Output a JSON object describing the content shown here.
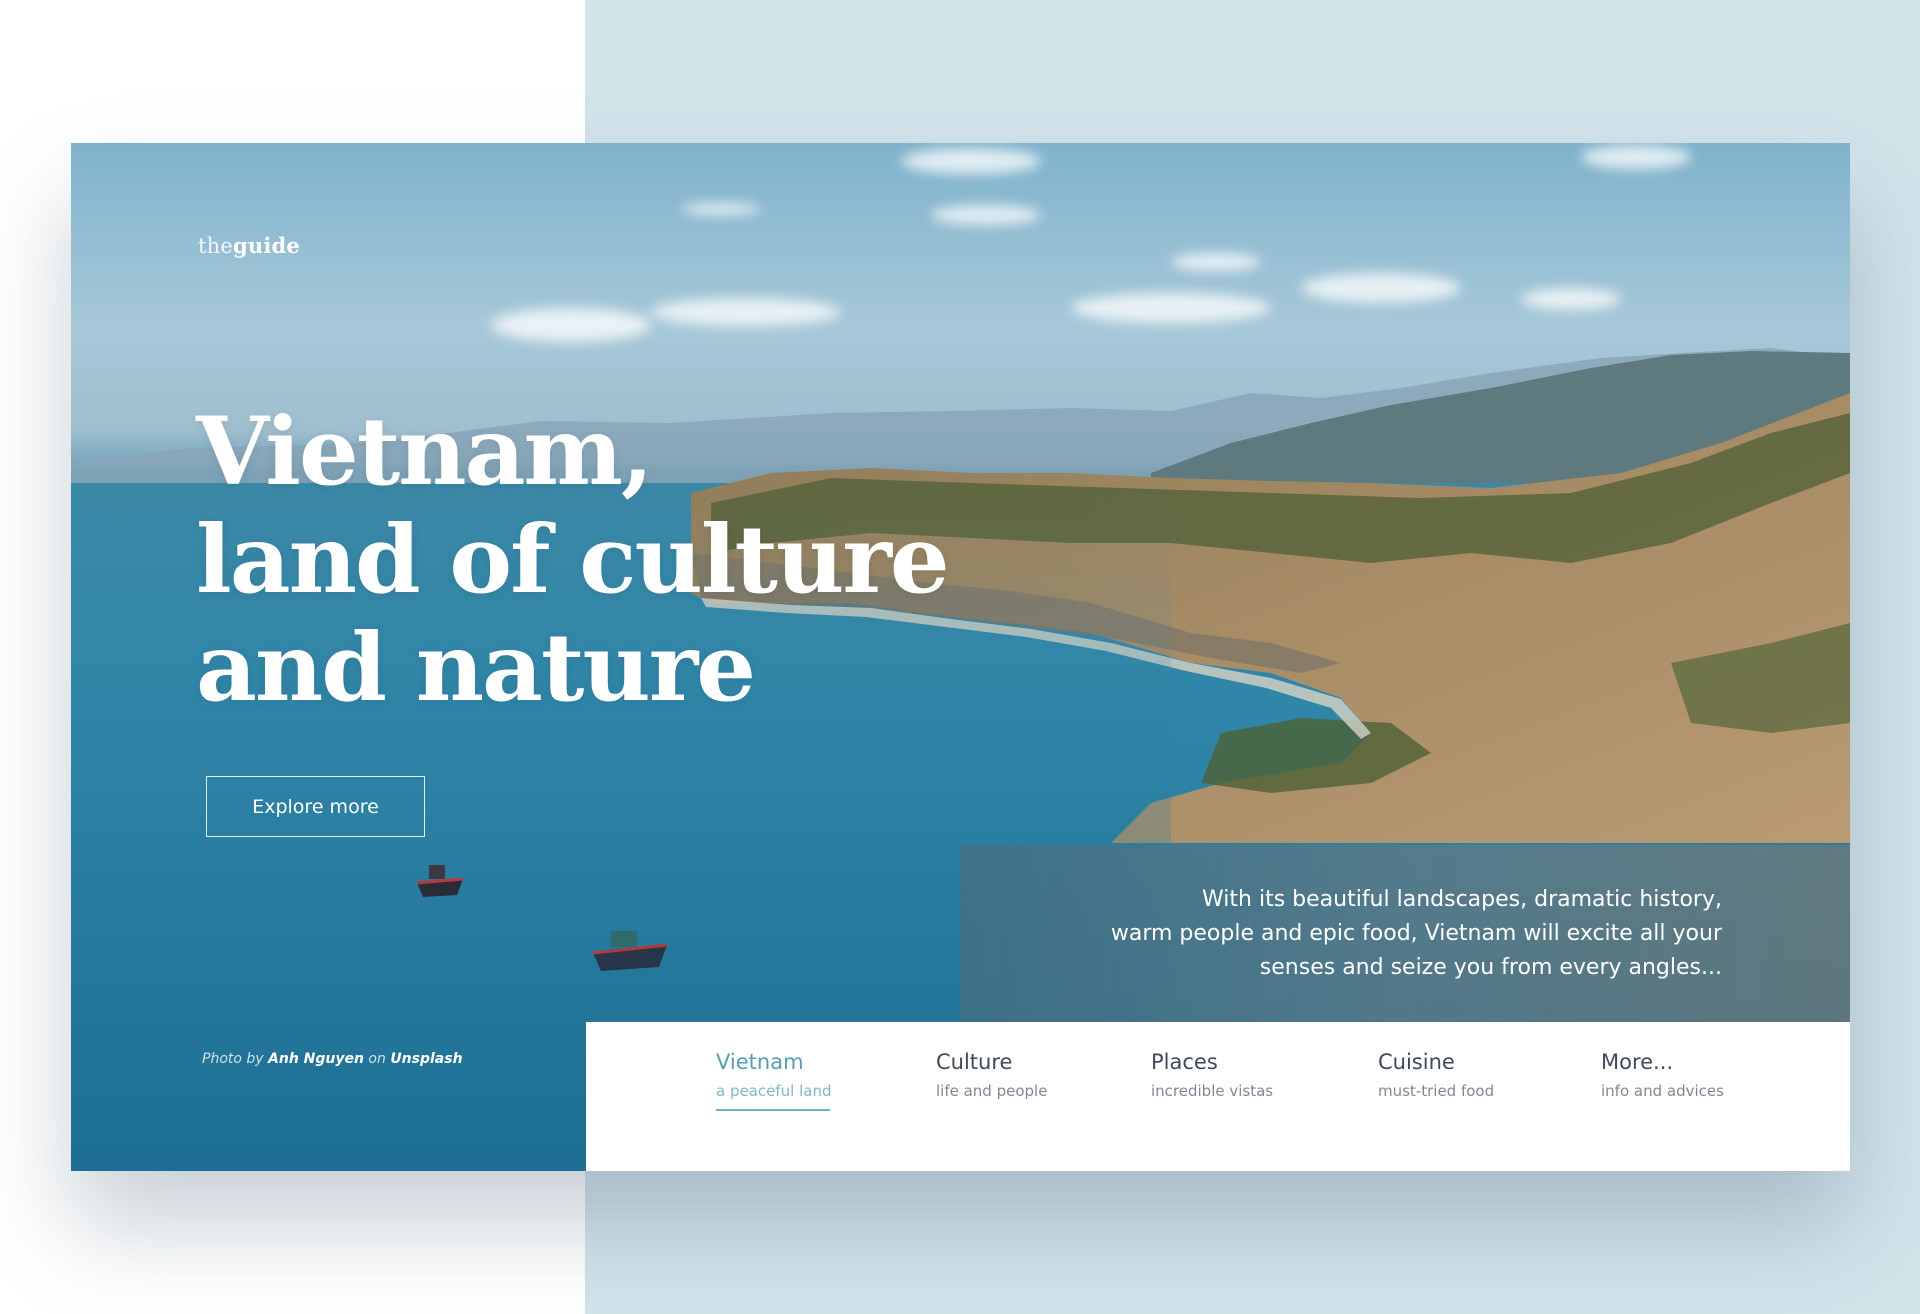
{
  "brand": {
    "logo_light": "the",
    "logo_bold": "guide"
  },
  "hero": {
    "headline_line1": "Vietnam,",
    "headline_line2": "land of culture",
    "headline_line3": "and nature",
    "cta_label": "Explore more",
    "credit_prefix": "Photo by",
    "credit_author": "Anh Nguyen",
    "credit_on": "on",
    "credit_source": "Unsplash"
  },
  "description": {
    "line1": "With its beautiful landscapes, dramatic history,",
    "line2": "warm people and epic food, Vietnam will excite all your",
    "line3": "senses and seize you from every angles..."
  },
  "nav": {
    "items": [
      {
        "title": "Vietnam",
        "subtitle": "a peaceful land",
        "active": true
      },
      {
        "title": "Culture",
        "subtitle": "life and people",
        "active": false
      },
      {
        "title": "Places",
        "subtitle": "incredible vistas",
        "active": false
      },
      {
        "title": "Cuisine",
        "subtitle": "must-tried food",
        "active": false
      },
      {
        "title": "More...",
        "subtitle": "info and advices",
        "active": false
      }
    ]
  },
  "colors": {
    "page_bg_right": "#d3e3ea",
    "accent": "#5a9db2",
    "nav_text": "#3f4a5a"
  }
}
